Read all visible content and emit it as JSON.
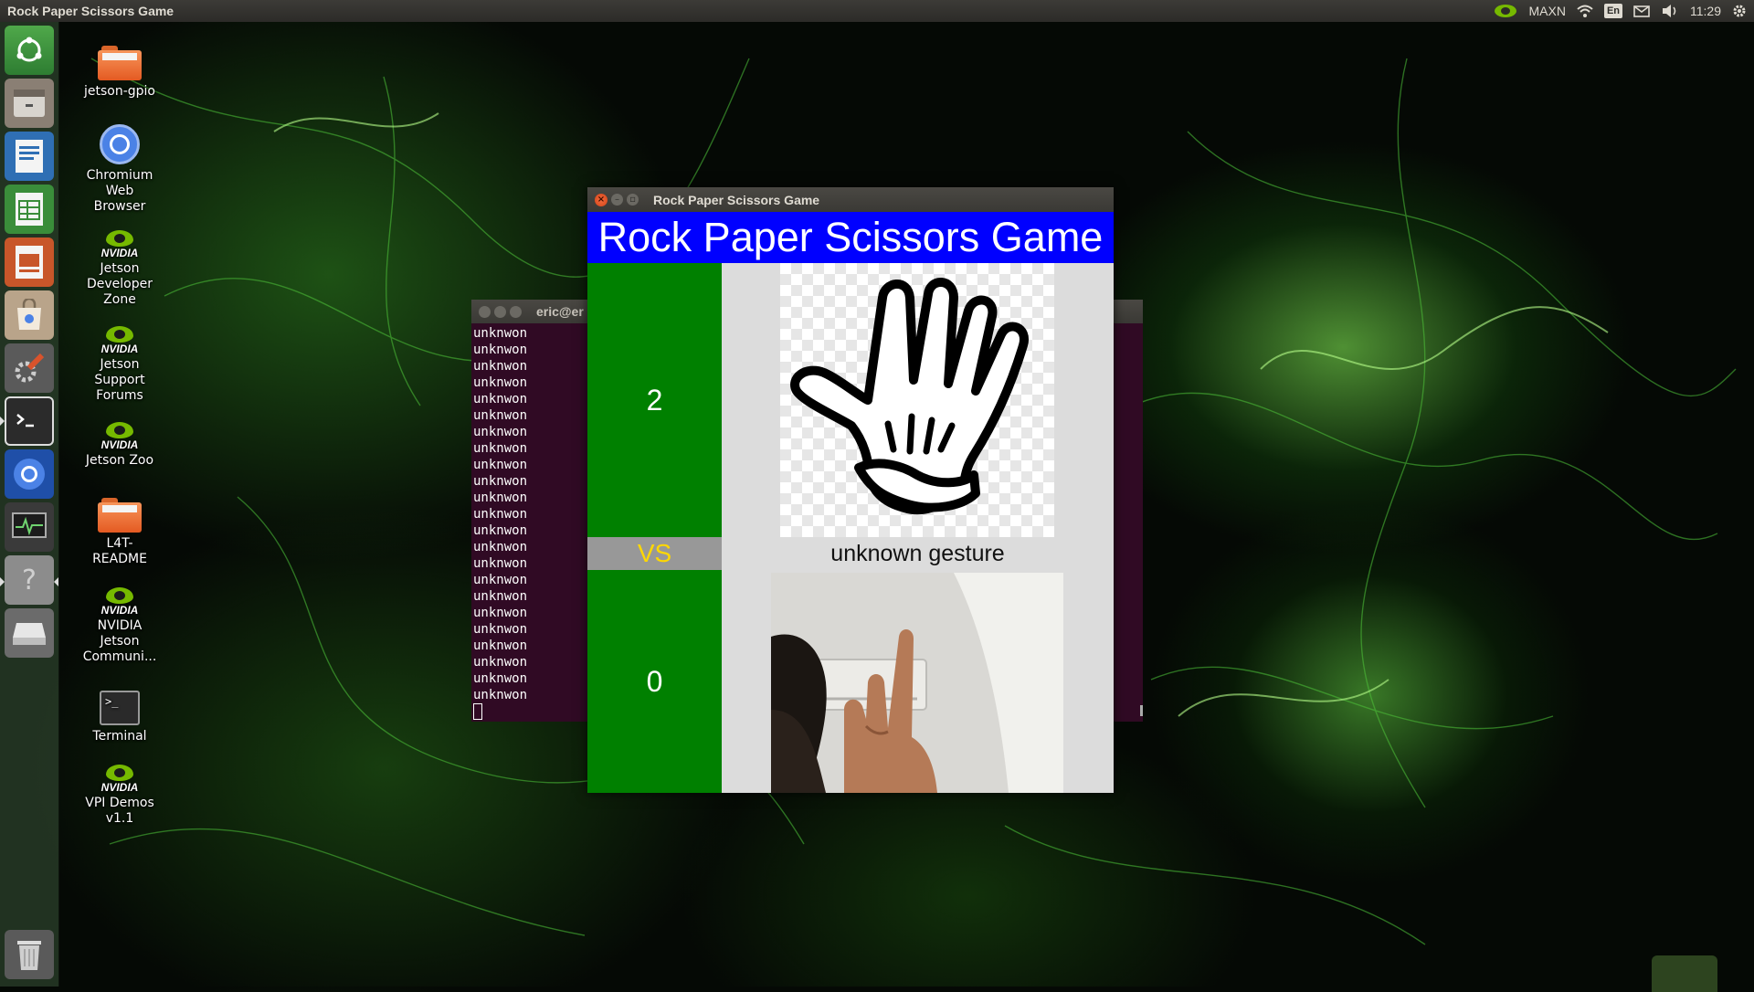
{
  "top_panel": {
    "app_title": "Rock Paper Scissors Game",
    "power_mode": "MAXN",
    "language": "En",
    "time": "11:29"
  },
  "launcher": {
    "items": [
      "dash-home",
      "files",
      "writer",
      "calc",
      "impress",
      "software",
      "system-settings",
      "terminal",
      "chromium",
      "system-monitor",
      "help",
      "drive",
      "trash"
    ]
  },
  "desktop_icons": [
    {
      "label": "jetson-gpio",
      "icon": "folder-icon"
    },
    {
      "label": "Chromium Web Browser",
      "icon": "chromium-icon"
    },
    {
      "label": "Jetson Developer Zone",
      "icon": "nvidia-icon"
    },
    {
      "label": "Jetson Support Forums",
      "icon": "nvidia-icon"
    },
    {
      "label": "Jetson Zoo",
      "icon": "nvidia-icon"
    },
    {
      "label": "L4T-README",
      "icon": "folder-icon"
    },
    {
      "label": "NVIDIA Jetson Communi...",
      "icon": "nvidia-icon"
    },
    {
      "label": "Terminal",
      "icon": "terminal-icon"
    },
    {
      "label": "VPI Demos v1.1",
      "icon": "nvidia-icon"
    }
  ],
  "terminal": {
    "title": "eric@er",
    "lines": [
      "unknwon",
      "unknwon",
      "unknwon",
      "unknwon",
      "unknwon",
      "unknwon",
      "unknwon",
      "unknwon",
      "unknwon",
      "unknwon",
      "unknwon",
      "unknwon",
      "unknwon",
      "unknwon",
      "unknwon",
      "unknwon",
      "unknwon",
      "unknwon",
      "unknwon",
      "unknwon",
      "unknwon",
      "unknwon",
      "unknwon"
    ]
  },
  "game": {
    "window_title": "Rock Paper Scissors Game",
    "banner": "Rock Paper Scissors Game",
    "computer_score": "2",
    "vs_label": "VS",
    "player_score": "0",
    "gesture_label": "unknown gesture",
    "computer_gesture_icon": "paper-hand-icon",
    "colors": {
      "banner": "#0000ff",
      "score_bg": "#008000",
      "vs_bg": "#989898",
      "vs_text": "#ffd700"
    }
  }
}
